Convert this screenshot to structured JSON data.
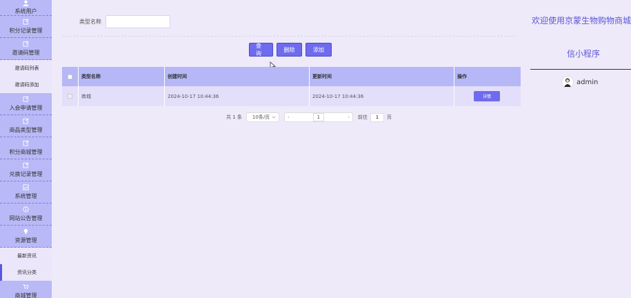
{
  "sidebar": {
    "top_item": "系统用户",
    "items": [
      {
        "label": "积分记录管理"
      },
      {
        "label": "邀请码管理"
      }
    ],
    "sub1": [
      {
        "label": "邀请码列表"
      },
      {
        "label": "邀请码添加"
      }
    ],
    "items2": [
      {
        "label": "入会申请管理"
      },
      {
        "label": "商品类型管理"
      },
      {
        "label": "积分商城管理"
      },
      {
        "label": "兑换记录管理"
      },
      {
        "label": "系统管理"
      },
      {
        "label": "网站公告管理"
      },
      {
        "label": "资源管理"
      }
    ],
    "sub2": [
      {
        "label": "最新资讯"
      },
      {
        "label": "资讯分类"
      }
    ],
    "bottom_item": "商城管理"
  },
  "search": {
    "label": "类型名称",
    "value": "",
    "placeholder": ""
  },
  "actions": {
    "query": "查询",
    "delete": "删除",
    "add": "添加"
  },
  "table": {
    "headers": [
      "类型名称",
      "创建时间",
      "更新时间",
      "操作"
    ],
    "rows": [
      {
        "name": "商城",
        "created": "2024-10-17 10:44:36",
        "updated": "2024-10-17 10:44:36",
        "action": "详情"
      }
    ]
  },
  "pagination": {
    "total": "共 1 条",
    "page_size": "10条/页",
    "current_page": "1",
    "goto_label": "前往",
    "goto_value": "1",
    "page_unit": "页"
  },
  "header_right": {
    "welcome_line1": "欢迎使用京蒙生物购物商城微",
    "welcome_line2": "信小程序",
    "username": "admin"
  },
  "colors": {
    "accent": "#6f6bee",
    "sidebar_bg": "#b8b9f6",
    "table_header_bg": "#b6b7f7",
    "page_bg": "#efeaf9"
  }
}
